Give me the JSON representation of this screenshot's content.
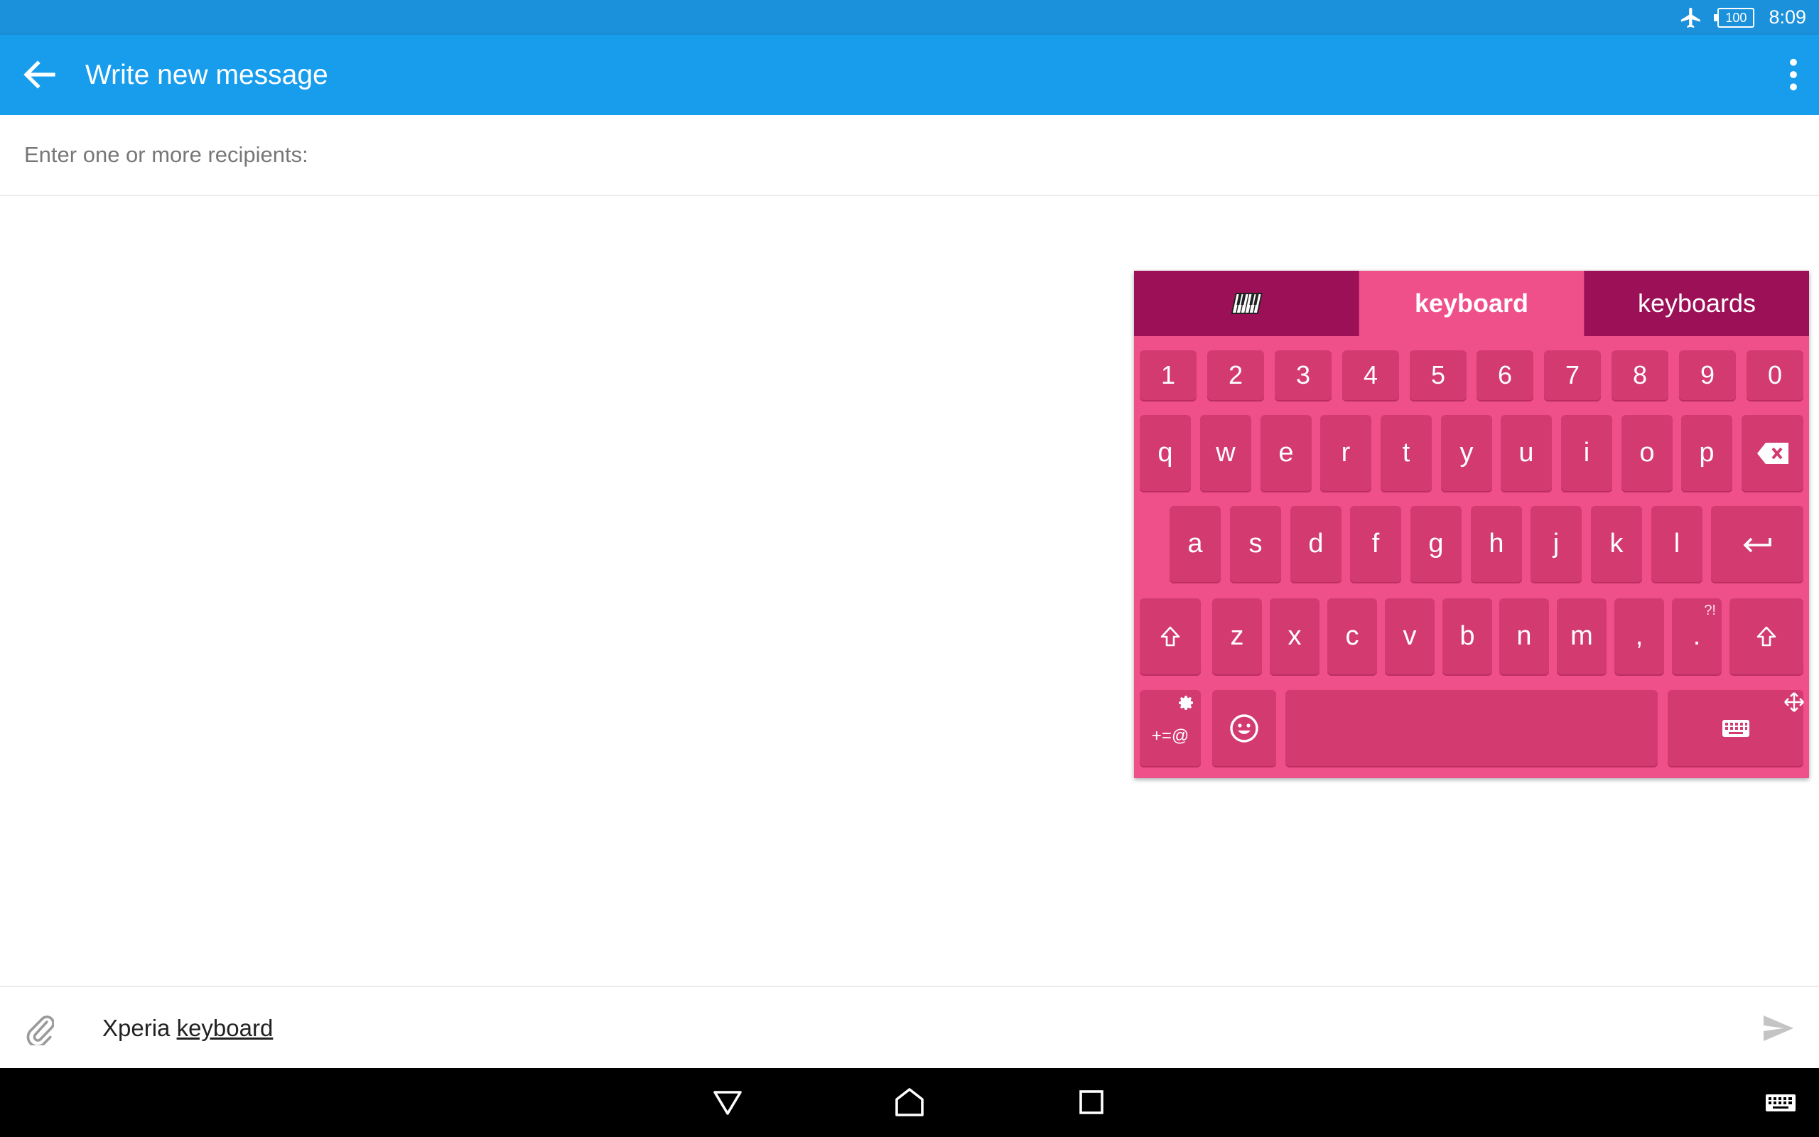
{
  "status_bar": {
    "battery": "100",
    "time": "8:09",
    "icons": [
      "airplane-mode-icon",
      "battery-icon"
    ]
  },
  "app_bar": {
    "title": "Write new message",
    "back_icon": "arrow-back-icon",
    "menu_icon": "more-vertical-icon"
  },
  "recipients": {
    "placeholder": "Enter one or more recipients:"
  },
  "keyboard": {
    "tabs": [
      {
        "label": "",
        "icon": "piano-keys-icon"
      },
      {
        "label": "keyboard"
      },
      {
        "label": "keyboards"
      }
    ],
    "number_row": [
      "1",
      "2",
      "3",
      "4",
      "5",
      "6",
      "7",
      "8",
      "9",
      "0"
    ],
    "row1": [
      "q",
      "w",
      "e",
      "r",
      "t",
      "y",
      "u",
      "i",
      "o",
      "p"
    ],
    "row2": [
      "a",
      "s",
      "d",
      "f",
      "g",
      "h",
      "j",
      "k",
      "l"
    ],
    "row3": [
      "z",
      "x",
      "c",
      "v",
      "b",
      "n",
      "m",
      ",",
      "."
    ],
    "period_hint": "?!",
    "symbols_label": "+=@",
    "colors": {
      "background": "#f0508a",
      "key": "#d23a70",
      "tab_dark": "#9c1057"
    }
  },
  "composer": {
    "text_plain": "Xperia ",
    "text_underlined": "keyboard",
    "attach_icon": "paperclip-icon",
    "send_icon": "send-icon"
  },
  "nav_bar": {
    "icons": [
      "back-triangle-icon",
      "home-icon",
      "recents-icon",
      "keyboard-switch-icon"
    ]
  }
}
